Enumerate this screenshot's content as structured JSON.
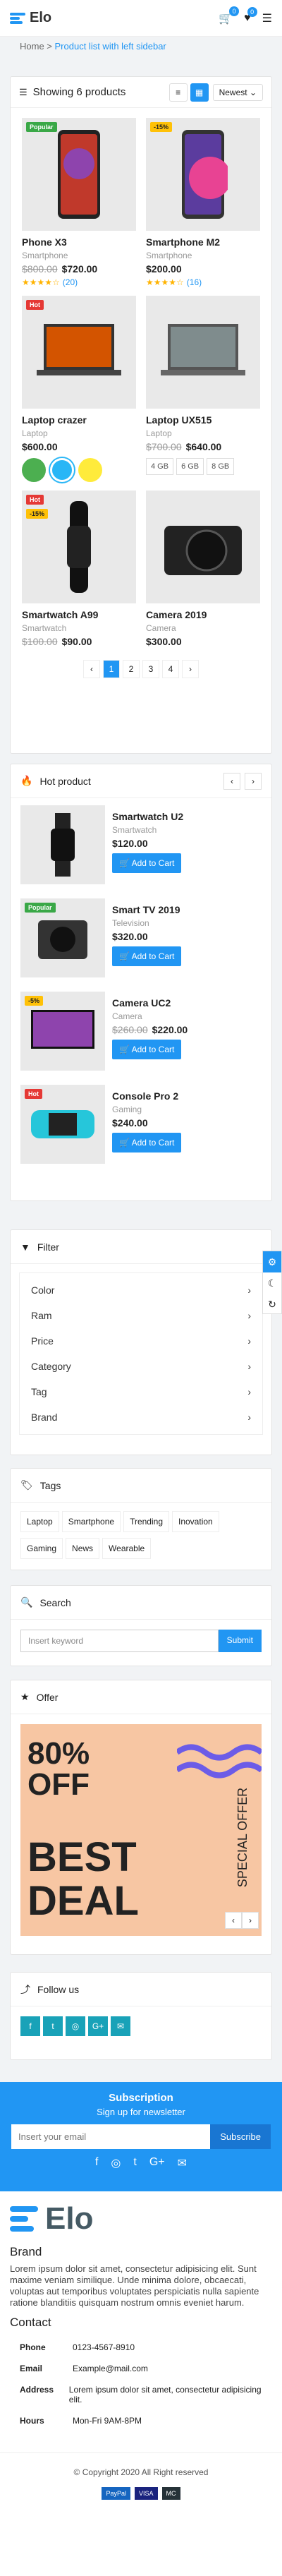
{
  "header": {
    "logo": "Elo",
    "cart_count": "0",
    "wish_count": "0"
  },
  "breadcrumb": {
    "home": "Home",
    "current": "Product list with left sidebar"
  },
  "products": {
    "showing": "Showing 6 products",
    "sort": "Newest",
    "items": [
      {
        "name": "Phone X3",
        "cat": "Smartphone",
        "old": "$800.00",
        "price": "$720.00",
        "reviews": "(20)",
        "tag": "Popular"
      },
      {
        "name": "Smartphone M2",
        "cat": "Smartphone",
        "old": "",
        "price": "$200.00",
        "reviews": "(16)",
        "tag": "-15%"
      },
      {
        "name": "Laptop crazer",
        "cat": "Laptop",
        "old": "",
        "price": "$600.00",
        "reviews": "",
        "tag": "Hot"
      },
      {
        "name": "Laptop UX515",
        "cat": "Laptop",
        "old": "$700.00",
        "price": "$640.00",
        "reviews": "",
        "tag": ""
      },
      {
        "name": "Smartwatch A99",
        "cat": "Smartwatch",
        "old": "$100.00",
        "price": "$90.00",
        "reviews": "",
        "tag": "Hot"
      },
      {
        "name": "Camera 2019",
        "cat": "Camera",
        "old": "",
        "price": "$300.00",
        "reviews": "",
        "tag": ""
      }
    ],
    "sizes": [
      "4 GB",
      "6 GB",
      "8 GB"
    ],
    "pages": [
      "1",
      "2",
      "3",
      "4"
    ]
  },
  "hot": {
    "title": "Hot product",
    "add": "Add to Cart",
    "items": [
      {
        "name": "Smartwatch U2",
        "cat": "Smartwatch",
        "old": "",
        "price": "$120.00",
        "tag": ""
      },
      {
        "name": "Smart TV 2019",
        "cat": "Television",
        "old": "",
        "price": "$320.00",
        "tag": "Popular"
      },
      {
        "name": "Camera UC2",
        "cat": "Camera",
        "old": "$260.00",
        "price": "$220.00",
        "tag": "-5%"
      },
      {
        "name": "Console Pro 2",
        "cat": "Gaming",
        "old": "",
        "price": "$240.00",
        "tag": "Hot"
      }
    ]
  },
  "filter": {
    "title": "Filter",
    "items": [
      "Color",
      "Ram",
      "Price",
      "Category",
      "Tag",
      "Brand"
    ]
  },
  "tags": {
    "title": "Tags",
    "items": [
      "Laptop",
      "Smartphone",
      "Trending",
      "Inovation",
      "Gaming",
      "News",
      "Wearable"
    ]
  },
  "search": {
    "title": "Search",
    "placeholder": "Insert keyword",
    "button": "Submit"
  },
  "offer": {
    "title": "Offer",
    "pct": "80%",
    "off": "OFF",
    "best": "BEST",
    "deal": "DEAL",
    "special": "SPECIAL OFFER"
  },
  "follow": {
    "title": "Follow us"
  },
  "newsletter": {
    "title": "Subscription",
    "sub": "Sign up for newsletter",
    "placeholder": "Insert your email",
    "button": "Subscribe"
  },
  "footer": {
    "logo": "Elo",
    "brand": "Brand",
    "brand_text": "Lorem ipsum dolor sit amet, consectetur adipisicing elit. Sunt maxime veniam similique. Unde minima dolore, obcaecati, voluptas aut temporibus voluptates perspiciatis nulla sapiente ratione blanditiis quisquam nostrum omnis eveniet harum.",
    "contact": "Contact",
    "phone_l": "Phone",
    "phone": "0123-4567-8910",
    "email_l": "Email",
    "email": "Example@mail.com",
    "addr_l": "Address",
    "addr": "Lorem ipsum dolor sit amet, consectetur adipisicing elit.",
    "hours_l": "Hours",
    "hours": "Mon-Fri 9AM-8PM",
    "copyright": "© Copyright 2020 All Right reserved",
    "pay": [
      "PayPal",
      "VISA",
      "MC"
    ]
  }
}
